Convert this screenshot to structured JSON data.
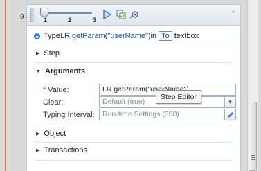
{
  "step": {
    "number": "9",
    "title_prefix": "Type ",
    "title_code": "LR.getParam(\"userName\")",
    "title_mid": " in ",
    "title_token": "To",
    "title_suffix": " textbox"
  },
  "toolbar": {
    "ticks": [
      "1",
      "2",
      "3"
    ],
    "icons": [
      "play-icon",
      "snapshot-icon",
      "properties-icon",
      "collapse-icon"
    ]
  },
  "sections": {
    "step_label": "Step",
    "arguments_label": "Arguments",
    "object_label": "Object",
    "transactions_label": "Transactions"
  },
  "arguments": {
    "value": {
      "required_mark": "*",
      "label": "Value:",
      "value": "LR.getParam(\"userName\")"
    },
    "clear": {
      "label": "Clear:",
      "value": "Default (true)"
    },
    "typing_interval": {
      "label": "Typing Interval:",
      "value": "Run-time Settings (350)"
    }
  },
  "tooltip": {
    "text": "Step Editor"
  },
  "colors": {
    "accent": "#1a4fa0",
    "required": "#d0332c",
    "bullet": "#3c86d8",
    "left_line": "#e07b4a"
  }
}
